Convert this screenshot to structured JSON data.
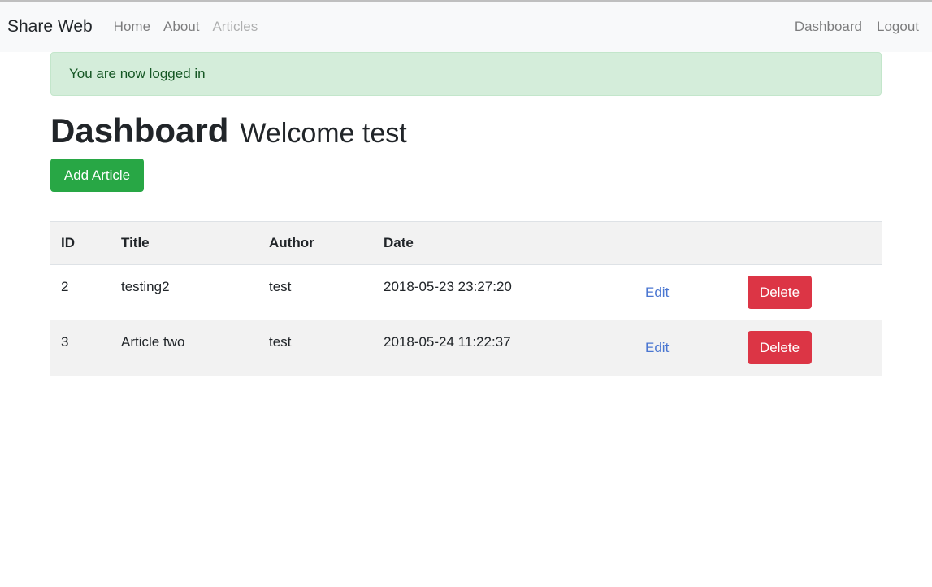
{
  "navbar": {
    "brand": "Share Web",
    "links": [
      {
        "label": "Home"
      },
      {
        "label": "About"
      },
      {
        "label": "Articles"
      }
    ],
    "right_links": [
      {
        "label": "Dashboard"
      },
      {
        "label": "Logout"
      }
    ]
  },
  "alert": {
    "message": "You are now logged in",
    "color": "#d4edda"
  },
  "header": {
    "title": "Dashboard",
    "welcome": "Welcome test",
    "add_button": "Add Article"
  },
  "table": {
    "columns": [
      "ID",
      "Title",
      "Author",
      "Date"
    ],
    "rows": [
      {
        "id": "2",
        "title": "testing2",
        "author": "test",
        "date": "2018-05-23 23:27:20",
        "edit": "Edit",
        "delete": "Delete"
      },
      {
        "id": "3",
        "title": "Article two",
        "author": "test",
        "date": "2018-05-24 11:22:37",
        "edit": "Edit",
        "delete": "Delete"
      }
    ]
  },
  "colors": {
    "success": "#28a745",
    "danger": "#dc3545",
    "link": "#4a76d1"
  }
}
